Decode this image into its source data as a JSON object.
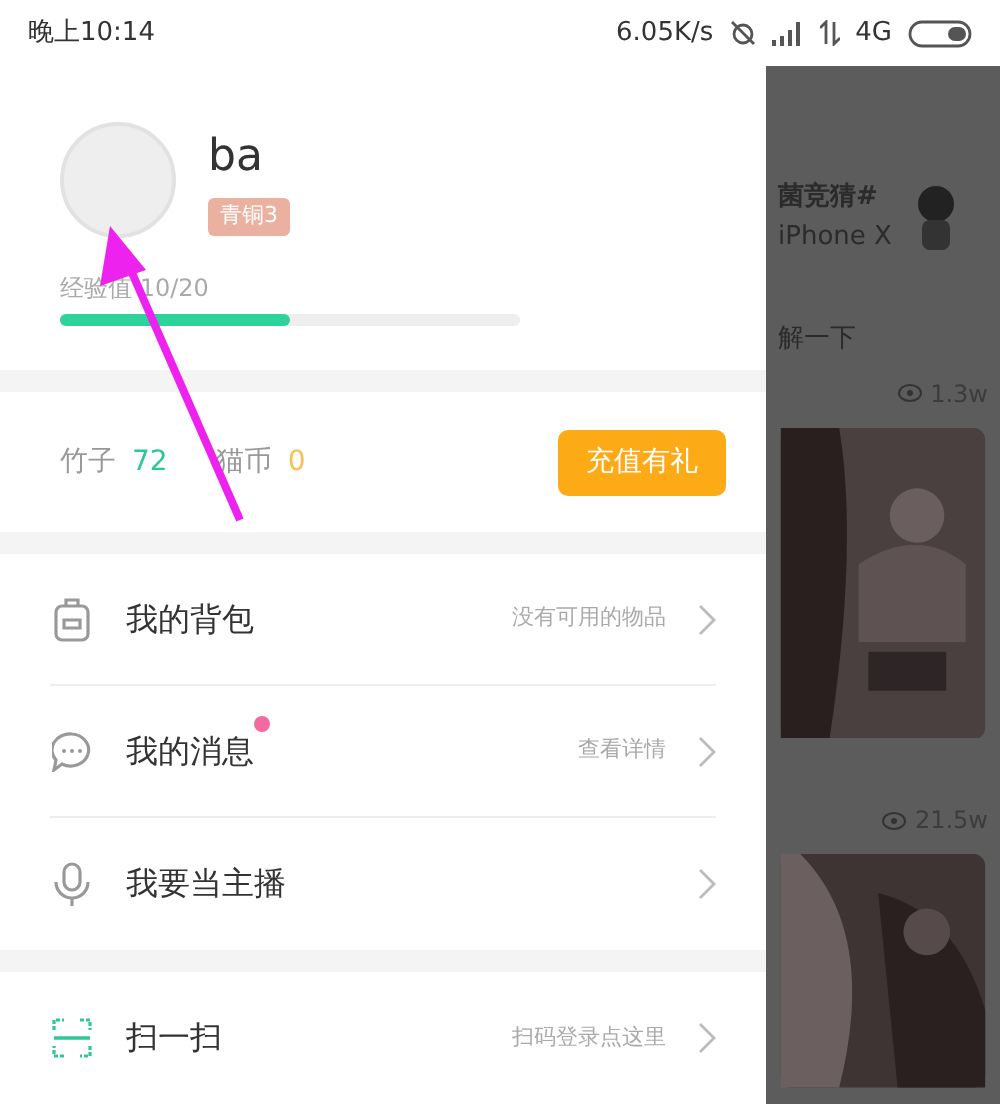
{
  "status_bar": {
    "time": "晚上10:14",
    "speed": "6.05K/s",
    "network": "4G"
  },
  "profile": {
    "username": "ba",
    "level_badge": "青铜3",
    "exp_label": "经验值 10/20",
    "exp": {
      "level": 0.5
    }
  },
  "wallet": {
    "bamboo_label": "竹子",
    "bamboo": "72",
    "coin_label": "猫币",
    "coins": "0",
    "recharge_button": "充值有礼"
  },
  "menu_groups": [
    [
      {
        "kind": "bag",
        "label": "我的背包",
        "hint": "没有可用的物品",
        "dot": false
      },
      {
        "kind": "message",
        "label": "我的消息",
        "hint": "查看详情",
        "dot": true
      },
      {
        "kind": "mic",
        "label": "我要当主播",
        "dot": false
      }
    ],
    [
      {
        "kind": "scan",
        "label": "扫一扫",
        "hint": "扫码登录点这里",
        "dot": false
      }
    ]
  ],
  "background_feed": {
    "title_1": "菌竞猜#",
    "title_2": "iPhone X",
    "title_3": "解一下",
    "views_1": "1.3w",
    "views_2": "21.5w"
  }
}
